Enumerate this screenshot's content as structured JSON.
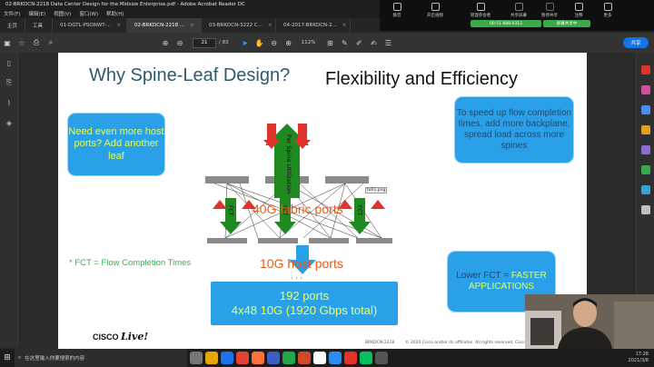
{
  "window": {
    "title": "02-BRKDCN-2218 Data Center Design for the Midsize Enterprise.pdf - Adobe Acrobat Reader DC"
  },
  "menu": [
    "文件(F)",
    "编辑(E)",
    "视图(V)",
    "窗口(W)",
    "帮助(H)"
  ],
  "meeting": {
    "buttons": [
      {
        "label": "静音",
        "icon": "mic-icon"
      },
      {
        "label": "开启视频",
        "icon": "video-icon"
      },
      {
        "label": "管理参会者",
        "icon": "participants-icon"
      },
      {
        "label": "共享屏幕",
        "icon": "share-screen-icon"
      },
      {
        "label": "暂停共享",
        "icon": "pause-icon"
      },
      {
        "label": "注释",
        "icon": "annotate-icon"
      },
      {
        "label": "更多",
        "icon": "more-icon"
      }
    ],
    "status_left": "00:51 888-0312",
    "status_right": "屏幕共享中"
  },
  "tabs": [
    {
      "label": "主页",
      "active": false
    },
    {
      "label": "工具",
      "active": false
    },
    {
      "label": "01-DGTL-PSONWT-...",
      "active": false
    },
    {
      "label": "02-BRKDCN-2218 ...",
      "active": true
    },
    {
      "label": "03-BRKDCN-3222 C...",
      "active": false
    },
    {
      "label": "04-2017-BRKDCN-2...",
      "active": false
    }
  ],
  "toolbar": {
    "page_current": "21",
    "page_total": "/ 83",
    "zoom": "112%",
    "share_label": "共享",
    "login": "登录"
  },
  "slide": {
    "title": "Why Spine-Leaf Design?",
    "subtitle": "Flexibility and Efficiency",
    "note_left": "Need even more host ports? Add another leaf",
    "note_right": "To speed up flow completion times, add more backplane, spread load across more spines",
    "fct_definition": "* FCT = Flow Completion Times",
    "fabric_ports": "40G fabric ports",
    "host_ports": "10G host ports",
    "arrow_up_label": "Per Spine Utilization",
    "arrow_down_label": "FCT",
    "ports_line1": "192 ports",
    "ports_line2": "4x48 10G (1920 Gbps total)",
    "dots": "· · ·",
    "fct_note_prefix": "Lower FCT = ",
    "fct_note_highlight": "FASTER APPLICATIONS",
    "fort_label": "foR1.png",
    "cisco": "CISCO",
    "live": "Live!",
    "footer_session": "BRKDCN-2218",
    "footer_copy": "© 2020 Cisco and/or its affiliates. All rights reserved. Cisco Public"
  },
  "taskbar": {
    "search_placeholder": "在这里输入你要搜索的内容",
    "time": "17:28",
    "date": "2021/3/8"
  },
  "colors": {
    "accent": "#2aa0e8",
    "orange": "#e35b1a",
    "green": "#1f8a1f",
    "red": "#e0332c",
    "highlight": "#dfff5a"
  }
}
